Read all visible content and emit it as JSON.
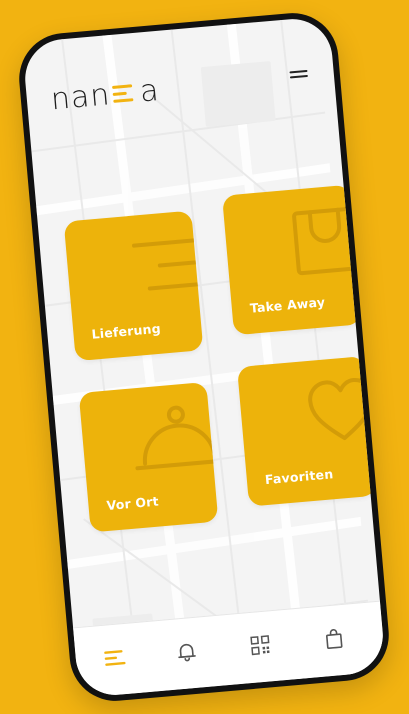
{
  "brand": {
    "logo_left": "nan",
    "logo_right": "a",
    "accent_color": "#F2B311"
  },
  "tiles": [
    {
      "label": "Lieferung",
      "icon": "delivery-lines-icon"
    },
    {
      "label": "Take Away",
      "icon": "shopping-bag-icon"
    },
    {
      "label": "Vor Ort",
      "icon": "cloche-icon"
    },
    {
      "label": "Favoriten",
      "icon": "heart-icon"
    }
  ],
  "navbar": {
    "items": [
      {
        "icon": "menu-lines-icon",
        "active": true
      },
      {
        "icon": "bell-icon",
        "active": false
      },
      {
        "icon": "qr-code-icon",
        "active": false
      },
      {
        "icon": "shopping-bag-icon",
        "active": false
      }
    ]
  },
  "colors": {
    "background": "#F2B311",
    "tile": "#EDB30B",
    "tile_icon": "#D39C08",
    "screen": "#F4F4F4",
    "nav_active": "#F2B311",
    "nav_inactive": "#555555"
  }
}
